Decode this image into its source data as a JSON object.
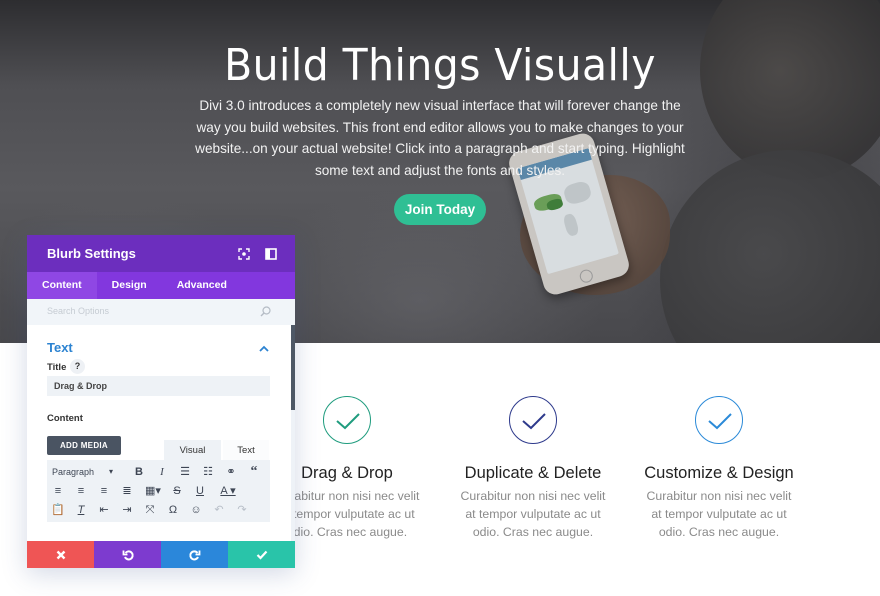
{
  "hero": {
    "title": "Build Things Visually",
    "text": "Divi 3.0 introduces a completely new visual interface that will forever change the way you build websites. This front end editor allows you to make changes to your website...on your actual website! Click into a paragraph and start typing. Highlight some text and adjust the fonts and styles.",
    "cta_label": "Join Today"
  },
  "features": [
    {
      "title": "Drag & Drop",
      "text": "Curabitur non nisi nec velit at tempor vulputate ac ut odio. Cras nec augue.",
      "color": "#1f9c7e"
    },
    {
      "title": "Duplicate & Delete",
      "text": "Curabitur non nisi nec velit at tempor vulputate ac ut odio. Cras nec augue.",
      "color": "#2e3a8c"
    },
    {
      "title": "Customize & Design",
      "text": "Curabitur non nisi nec velit at tempor vulputate ac ut odio. Cras nec augue.",
      "color": "#2b8ad8"
    }
  ],
  "panel": {
    "title": "Blurb Settings",
    "header_icons": [
      "expand-icon",
      "split-view-icon"
    ],
    "tabs": [
      {
        "label": "Content",
        "active": true
      },
      {
        "label": "Design",
        "active": false
      },
      {
        "label": "Advanced",
        "active": false
      }
    ],
    "search_placeholder": "Search Options",
    "section_title": "Text",
    "title_label": "Title",
    "help_label": "?",
    "title_value": "Drag & Drop",
    "content_label": "Content",
    "add_media_label": "ADD MEDIA",
    "editor_tabs": {
      "visual": "Visual",
      "text": "Text"
    },
    "toolbar": {
      "format_select": "Paragraph",
      "row1": [
        "bold",
        "italic",
        "bullet-list",
        "numbered-list",
        "link",
        "blockquote"
      ],
      "row2": [
        "align-left",
        "align-center",
        "align-right",
        "justify",
        "table",
        "strikethrough",
        "underline",
        "text-color"
      ],
      "row3": [
        "paste-as-text",
        "clear-formatting",
        "outdent",
        "indent",
        "fullscreen",
        "special-character",
        "emoji",
        "undo",
        "redo"
      ]
    },
    "footer_buttons": [
      {
        "name": "discard",
        "color": "#ef5555"
      },
      {
        "name": "undo",
        "color": "#7d3bcf"
      },
      {
        "name": "redo",
        "color": "#2b87da"
      },
      {
        "name": "save",
        "color": "#29c4a9"
      }
    ]
  }
}
